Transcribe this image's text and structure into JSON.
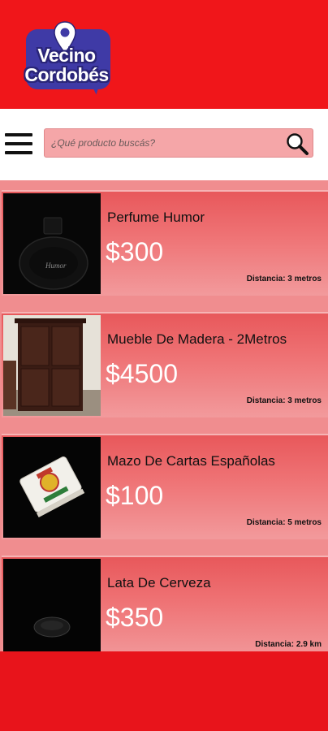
{
  "app": {
    "logo_line1": "Vecino",
    "logo_line2": "Cordobés"
  },
  "colors": {
    "brand_red": "#f0161a",
    "logo_blue": "#3f3aa6",
    "card_pink": "#ef7476",
    "search_bg": "#f5a6a8"
  },
  "toolbar": {
    "menu_icon": "hamburger-menu-icon",
    "search_placeholder": "¿Qué producto buscás?",
    "search_icon": "magnifier-icon"
  },
  "products": [
    {
      "title": "Perfume Humor",
      "price": "$300",
      "distance": "Distancia: 3 metros",
      "image": "perfume-bottle"
    },
    {
      "title": "Mueble De Madera - 2Metros",
      "price": "$4500",
      "distance": "Distancia: 3 metros",
      "image": "wooden-wardrobe"
    },
    {
      "title": "Mazo De Cartas Españolas",
      "price": "$100",
      "distance": "Distancia: 5 metros",
      "image": "card-deck"
    },
    {
      "title": "Lata De Cerveza",
      "price": "$350",
      "distance": "Distancia: 2.9 km",
      "image": "beer-can"
    }
  ]
}
